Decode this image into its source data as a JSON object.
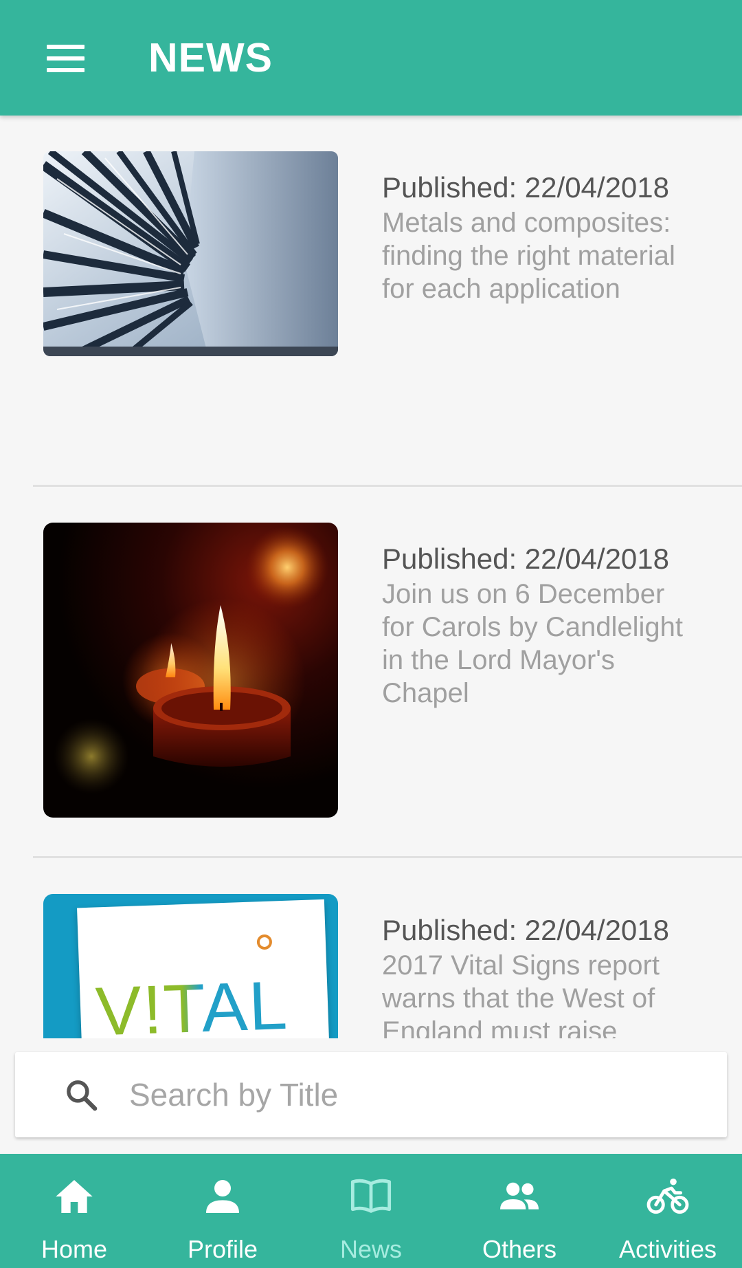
{
  "app_bar": {
    "title": "NEWS",
    "menu_icon": "hamburger-menu-icon"
  },
  "news": [
    {
      "published": "Published: 22/04/2018",
      "headline": "Metals and composites: finding the right material for each application",
      "image": "carbon-fibre-structure-photo"
    },
    {
      "published": "Published: 22/04/2018",
      "headline": "Join us on 6 December for Carols by Candlelight in the Lord Mayor's Chapel",
      "image": "candles-photo"
    },
    {
      "published": "Published: 22/04/2018",
      "headline": "2017 Vital Signs report warns that the West of England must raise",
      "image": "vital-signs-report-cover",
      "image_text": "V!TAL"
    }
  ],
  "search": {
    "placeholder": "Search by Title",
    "value": "",
    "icon": "search-icon"
  },
  "bottom_nav": {
    "items": [
      {
        "label": "Home",
        "icon": "home-icon",
        "active": false
      },
      {
        "label": "Profile",
        "icon": "person-icon",
        "active": false
      },
      {
        "label": "News",
        "icon": "book-icon",
        "active": true
      },
      {
        "label": "Others",
        "icon": "people-icon",
        "active": false
      },
      {
        "label": "Activities",
        "icon": "bicycle-icon",
        "active": false
      }
    ]
  },
  "colors": {
    "primary": "#35b59c",
    "active_nav": "#a7ece0",
    "background": "#f6f6f6"
  }
}
